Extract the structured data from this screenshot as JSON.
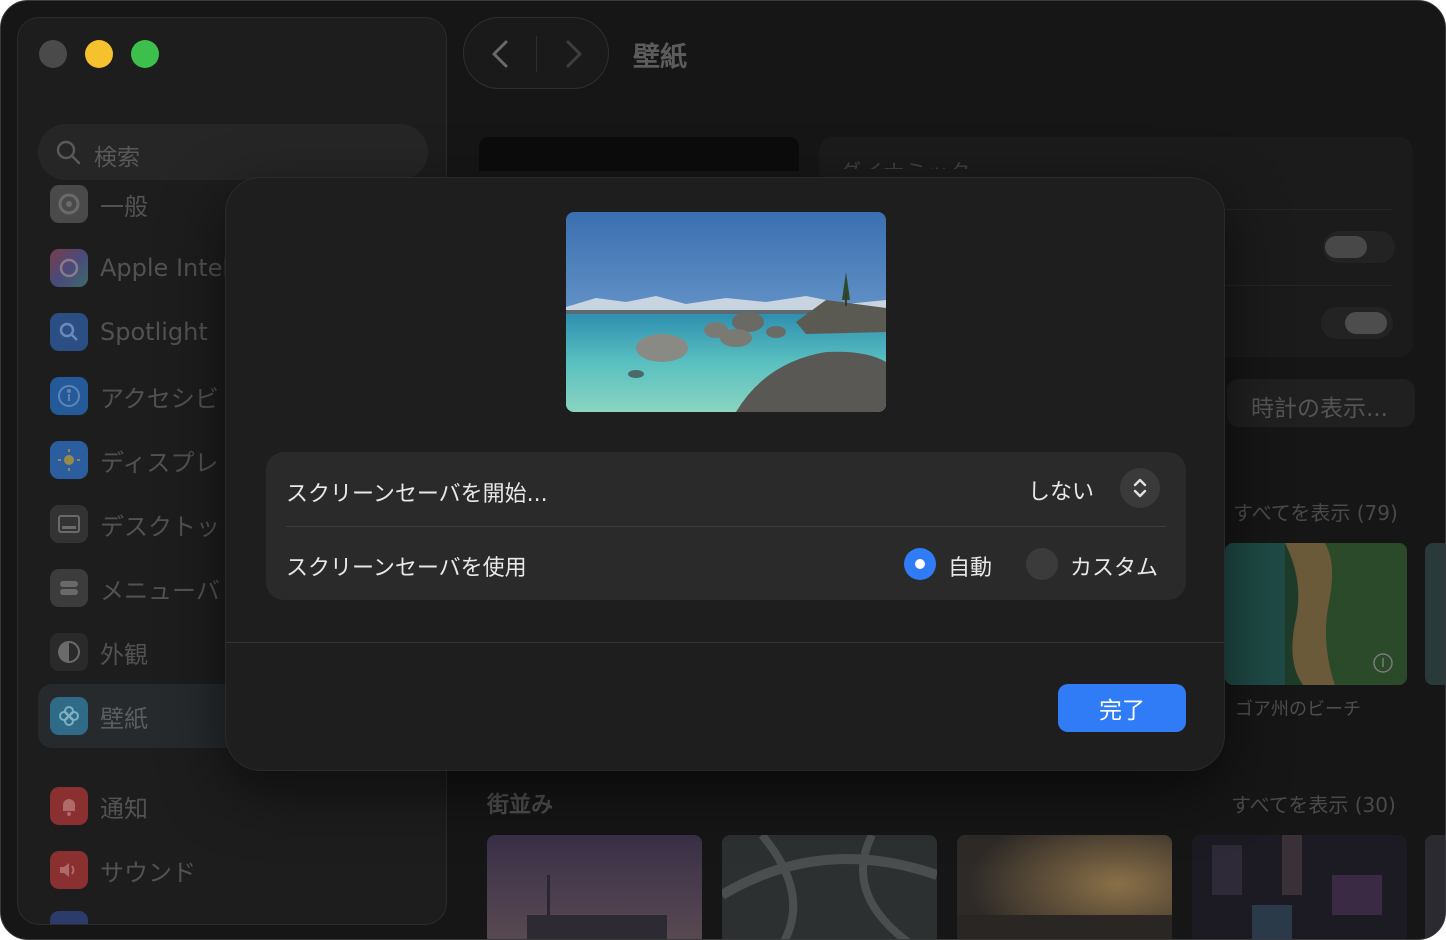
{
  "window": {
    "title": "壁紙"
  },
  "sidebar": {
    "search_placeholder": "検索",
    "items": [
      {
        "label": "一般",
        "icon": "gear-icon",
        "color": "#4a4a4a"
      },
      {
        "label": "Apple Intel",
        "icon": "apple-intelligence-icon",
        "color": "#6b4a6e"
      },
      {
        "label": "Spotlight",
        "icon": "magnifier-icon",
        "color": "#2b4f85"
      },
      {
        "label": "アクセシビ",
        "icon": "accessibility-icon",
        "color": "#245a9a"
      },
      {
        "label": "ディスプレ",
        "icon": "brightness-icon",
        "color": "#2b5e9e"
      },
      {
        "label": "デスクトッ",
        "icon": "dock-icon",
        "color": "#333333"
      },
      {
        "label": "メニューバ",
        "icon": "menubar-icon",
        "color": "#3c3c3c"
      },
      {
        "label": "外観",
        "icon": "appearance-icon",
        "color": "#2a2a2a"
      },
      {
        "label": "壁紙",
        "icon": "wallpaper-icon",
        "color": "#2f6a86",
        "active": true
      },
      {
        "label": "通知",
        "icon": "bell-icon",
        "color": "#8a3030"
      },
      {
        "label": "サウンド",
        "icon": "speaker-icon",
        "color": "#8a3030"
      }
    ]
  },
  "main": {
    "panel_title": "ダイナミック",
    "clock_button": "時計の表示...",
    "show_all_1": "すべてを表示 (79)",
    "thumb_caption": "ゴア州のビーチ",
    "section_title": "街並み",
    "show_all_2": "すべてを表示 (30)"
  },
  "modal": {
    "row1_label": "スクリーンセーバを開始...",
    "row1_value": "しない",
    "row2_label": "スクリーンセーバを使用",
    "radio_auto": "自動",
    "radio_custom": "カスタム",
    "selected": "自動",
    "done_button": "完了"
  },
  "colors": {
    "accent": "#2f7cf6",
    "modal_bg": "#1e1e1e",
    "card_bg": "#2a2a2a"
  }
}
